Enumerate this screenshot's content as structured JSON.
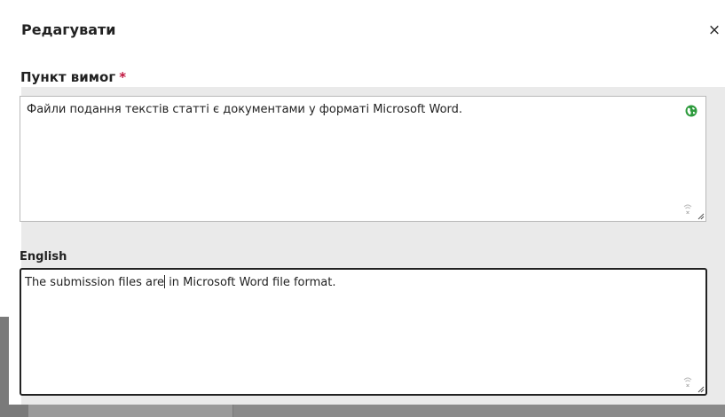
{
  "modal": {
    "title": "Редагувати",
    "close_label": "×"
  },
  "field": {
    "label": "Пункт вимог",
    "required_marker": "*",
    "value": "Файли подання текстів статті є документами у форматі Microsoft Word.",
    "language_icon": "globe-icon"
  },
  "translation": {
    "language_label": "English",
    "value_before_cursor": "The submission files are",
    "value_after_cursor": " in Microsoft Word file format."
  },
  "colors": {
    "required": "#c0163f",
    "globe": "#2e9b3d",
    "field_band": "#eaeaea"
  }
}
